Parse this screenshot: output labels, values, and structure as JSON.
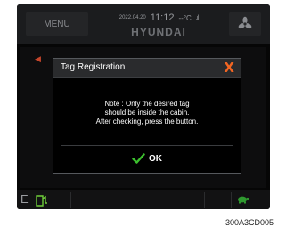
{
  "header": {
    "menu_label": "MENU",
    "date": "2022.04.20",
    "time": "11:12",
    "temperature": "--°C",
    "signal": ".ıl",
    "brand": "HYUNDAI"
  },
  "dialog": {
    "title": "Tag Registration",
    "close_glyph": "X",
    "message_lines": [
      "Note : Only the desired tag",
      "should be inside the cabin.",
      "After checking, press the button."
    ],
    "ok_label": "OK"
  },
  "footer": {
    "gear_label": "E"
  },
  "caption": "300A3CD005",
  "icons": [
    "fan-icon",
    "back-arrow-icon",
    "close-icon",
    "check-icon",
    "fuel-icon",
    "turtle-icon"
  ],
  "colors": {
    "accent_orange": "#f26522",
    "check_green": "#3cc02e",
    "fuel_green": "#6fce3a",
    "turtle_green": "#2f9a2f",
    "screen_bg": "#060606"
  }
}
